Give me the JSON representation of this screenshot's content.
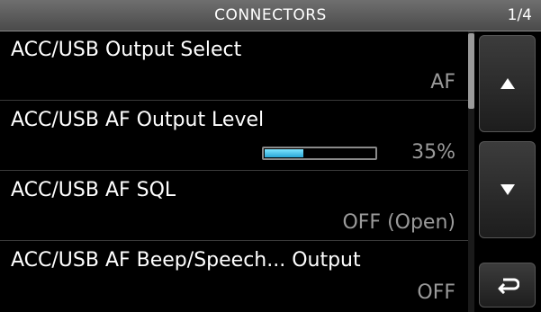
{
  "header": {
    "title": "CONNECTORS",
    "page": "1/4"
  },
  "items": [
    {
      "label": "ACC/USB Output Select",
      "value": "AF"
    },
    {
      "label": "ACC/USB AF Output Level",
      "value": "35%",
      "level": 0.35
    },
    {
      "label": "ACC/USB AF SQL",
      "value": "OFF (Open)"
    },
    {
      "label": "ACC/USB AF Beep/Speech... Output",
      "value": "OFF"
    }
  ],
  "buttons": {
    "up_icon": "arrow-up-icon",
    "down_icon": "arrow-down-icon",
    "back_icon": "return-icon"
  },
  "colors": {
    "level_fill": "#3ab8e6",
    "value_text": "#9a9a9a"
  }
}
